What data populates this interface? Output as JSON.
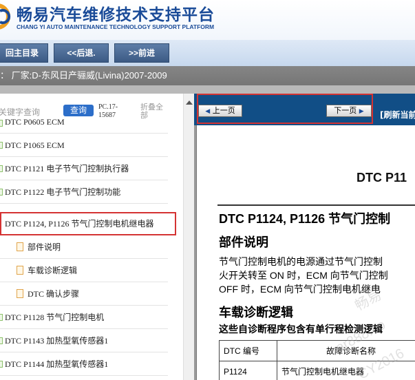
{
  "header": {
    "title_cn": "畅易汽车维修技术支持平台",
    "title_en": "CHANG YI AUTO MAINTENANCE TECHNOLOGY SUPPORT PLATFORM",
    "brand_color": "#1a4b98"
  },
  "nav": {
    "home": "回主目录",
    "back": "<<后退.",
    "forward": ">>前进"
  },
  "breadcrumb": {
    "text": "： 厂家:D-东风日产骊威(Livina)2007-2009"
  },
  "sidebar": {
    "search_label": "关键字查询",
    "search_button": "查询",
    "pc_code_line1": "PC.17-",
    "pc_code_line2": "15687",
    "collapse_all": "折叠全部",
    "items": [
      {
        "label": "DTC P0605 ECM",
        "icon": "page-green-icon"
      },
      {
        "label": "DTC P1065 ECM",
        "icon": "page-green-icon"
      },
      {
        "label": "DTC P1121 电子节气门控制执行器",
        "icon": "page-green-icon"
      },
      {
        "label": "DTC P1122 电子节气门控制功能",
        "icon": "page-green-icon"
      },
      {
        "label": "DTC P1124, P1126 节气门控制电机继电器",
        "icon": "none",
        "selected": true
      },
      {
        "label": "部件说明",
        "icon": "document-orange-icon"
      },
      {
        "label": "车载诊断逻辑",
        "icon": "document-orange-icon"
      },
      {
        "label": "DTC 确认步骤",
        "icon": "document-orange-icon"
      },
      {
        "label": "DTC P1128 节气门控制电机",
        "icon": "page-green-icon"
      },
      {
        "label": "DTC P1143 加热型氧传感器1",
        "icon": "page-green-icon"
      },
      {
        "label": "DTC P1144 加热型氧传感器1",
        "icon": "page-green-icon"
      }
    ]
  },
  "pager": {
    "prev": "上一页",
    "next": "下一页",
    "refresh": "[刷新当前"
  },
  "doc": {
    "head": "DTC P11",
    "h1": "DTC P1124, P1126 节气门控制",
    "section1": "部件说明",
    "para1_line1": "节气门控制电机的电源通过节气门控制",
    "para1_line2": "火开关转至 ON 时，ECM 向节气门控制",
    "para1_line3": "OFF 时，ECM 向节气门控制电机继电",
    "section2": "车载诊断逻辑",
    "subtitle": "这些自诊断程序包含有单行程检测逻辑",
    "table_headers": [
      "DTC 编号",
      "故障诊断名称"
    ],
    "table_rows": [
      [
        "P1124",
        "节气门控制电机继电器"
      ]
    ],
    "watermark1": "畅易",
    "watermark2": "car888.co",
    "watermark3": "CY2016"
  }
}
